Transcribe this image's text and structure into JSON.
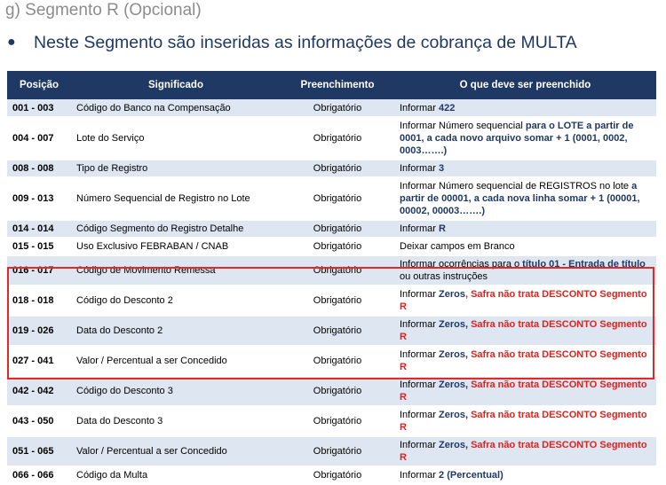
{
  "heading": "g) Segmento R (Opcional)",
  "bullet": "Neste Segmento são inseridas as informações de cobrança de MULTA",
  "table": {
    "headers": [
      "Posição",
      "Significado",
      "Preenchimento",
      "O que  deve ser preenchido"
    ],
    "rows": [
      {
        "pos": "001 - 003",
        "sig": "Código do Banco na Compensação",
        "fill": "Obrigatório",
        "what": [
          {
            "t": "Informar "
          },
          {
            "t": "422",
            "s": "b"
          }
        ]
      },
      {
        "pos": "004 - 007",
        "sig": "Lote do Serviço",
        "fill": "Obrigatório",
        "what": [
          {
            "t": "Informar Número sequencial "
          },
          {
            "t": "para o LOTE a partir de 0001, a cada novo arquivo somar + 1 (0001, 0002, 0003…….)",
            "s": "b"
          }
        ]
      },
      {
        "pos": "008 - 008",
        "sig": "Tipo de Registro",
        "fill": "Obrigatório",
        "what": [
          {
            "t": "Informar "
          },
          {
            "t": "3",
            "s": "b"
          }
        ]
      },
      {
        "pos": "009 - 013",
        "sig": "Número Sequencial de Registro no Lote",
        "fill": "Obrigatório",
        "what": [
          {
            "t": "Informar Número sequencial de REGISTROS no lote "
          },
          {
            "t": "a partir de 00001, a cada nova linha somar + 1 (00001, 00002, 00003…….)",
            "s": "b"
          }
        ]
      },
      {
        "pos": "014 - 014",
        "sig": "Código Segmento do Registro Detalhe",
        "fill": "Obrigatório",
        "what": [
          {
            "t": "Informar "
          },
          {
            "t": "R",
            "s": "b"
          }
        ]
      },
      {
        "pos": "015 - 015",
        "sig": "Uso Exclusivo FEBRABAN / CNAB",
        "fill": "Obrigatório",
        "what": [
          {
            "t": "Deixar campos em Branco"
          }
        ]
      },
      {
        "pos": "016 - 017",
        "sig": "Código de Movimento Remessa",
        "fill": "Obrigatório",
        "what": [
          {
            "t": "Informar ocorrências para o "
          },
          {
            "t": "título 01 - Entrada de título",
            "s": "b"
          },
          {
            "t": " ou outras instruções"
          }
        ]
      },
      {
        "pos": "018 - 018",
        "sig": "Código do Desconto 2",
        "fill": "Obrigatório",
        "what": [
          {
            "t": "Informar "
          },
          {
            "t": "Zeros",
            "s": "b"
          },
          {
            "t": ", Safra não trata DESCONTO Segmento R",
            "s": "red"
          }
        ]
      },
      {
        "pos": "019 - 026",
        "sig": "Data do Desconto 2",
        "fill": "Obrigatório",
        "what": [
          {
            "t": "Informar "
          },
          {
            "t": "Zeros,",
            "s": "b"
          },
          {
            "t": " Safra não trata DESCONTO Segmento R",
            "s": "red"
          }
        ]
      },
      {
        "pos": "027 - 041",
        "sig": "Valor / Percentual a ser Concedido",
        "fill": "Obrigatório",
        "what": [
          {
            "t": "Informar "
          },
          {
            "t": "Zeros,",
            "s": "b"
          },
          {
            "t": " Safra não trata DESCONTO Segmento R",
            "s": "red"
          }
        ]
      },
      {
        "pos": "042 - 042",
        "sig": "Código do Desconto 3",
        "fill": "Obrigatório",
        "what": [
          {
            "t": "Informar "
          },
          {
            "t": "Zeros,",
            "s": "b"
          },
          {
            "t": " Safra não trata DESCONTO Segmento R",
            "s": "red"
          }
        ]
      },
      {
        "pos": "043 - 050",
        "sig": "Data do Desconto 3",
        "fill": "Obrigatório",
        "what": [
          {
            "t": "Informar "
          },
          {
            "t": "Zeros,",
            "s": "b"
          },
          {
            "t": " Safra não trata DESCONTO Segmento R",
            "s": "red"
          }
        ]
      },
      {
        "pos": "051 - 065",
        "sig": "Valor / Percentual a ser Concedido",
        "fill": "Obrigatório",
        "what": [
          {
            "t": "Informar "
          },
          {
            "t": "Zeros,",
            "s": "b"
          },
          {
            "t": " Safra não trata DESCONTO Segmento R",
            "s": "red"
          }
        ]
      },
      {
        "pos": "066 - 066",
        "sig": "Código da Multa",
        "fill": "Obrigatório",
        "what": [
          {
            "t": "Informar "
          },
          {
            "t": "2 (Percentual)",
            "s": "b"
          }
        ]
      }
    ]
  },
  "colors": {
    "header_bg": "#1f3864",
    "row_alt": "#dde6f1",
    "highlight": "#e02a2a",
    "emphasis": "#1f3864",
    "warning": "#e0221e"
  }
}
